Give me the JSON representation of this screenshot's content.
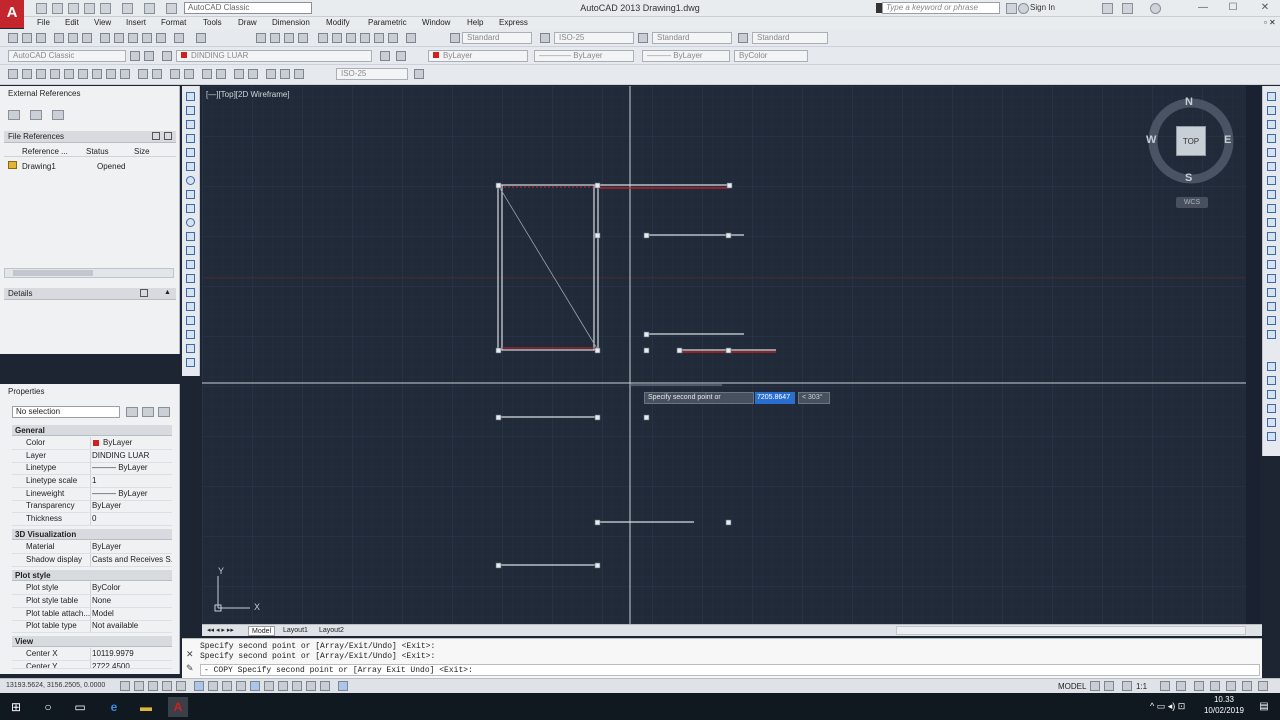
{
  "titlebar": {
    "workspace": "AutoCAD Classic",
    "title": "AutoCAD 2013   Drawing1.dwg",
    "search_placeholder": "Type a keyword or phrase",
    "signin": "Sign In"
  },
  "menu": [
    "File",
    "Edit",
    "View",
    "Insert",
    "Format",
    "Tools",
    "Draw",
    "Dimension",
    "Modify",
    "Parametric",
    "Window",
    "Help",
    "Express"
  ],
  "toolbar": {
    "text_style": "Standard",
    "dim_style": "ISO-25",
    "table_style": "Standard",
    "mleader_style": "Standard",
    "workspace2": "AutoCAD Classic",
    "layer": "DINDING LUAR",
    "color": "ByLayer",
    "linetype": "ByLayer",
    "lineweight": "ByLayer",
    "plotstyle": "ByColor",
    "dimstyle2": "ISO-25"
  },
  "xref": {
    "title": "External References",
    "file_refs": "File References",
    "columns": [
      "Reference ...",
      "Status",
      "Size"
    ],
    "rows": [
      {
        "name": "Drawing1",
        "status": "Opened",
        "size": ""
      }
    ],
    "details": "Details"
  },
  "properties": {
    "title": "Properties",
    "selection": "No selection",
    "sections": {
      "general": "General",
      "viz": "3D Visualization",
      "plot": "Plot style",
      "view": "View"
    },
    "general": [
      {
        "label": "Color",
        "value": "ByLayer"
      },
      {
        "label": "Layer",
        "value": "DINDING LUAR"
      },
      {
        "label": "Linetype",
        "value": "——— ByLayer"
      },
      {
        "label": "Linetype scale",
        "value": "1"
      },
      {
        "label": "Lineweight",
        "value": "——— ByLayer"
      },
      {
        "label": "Transparency",
        "value": "ByLayer"
      },
      {
        "label": "Thickness",
        "value": "0"
      }
    ],
    "viz": [
      {
        "label": "Material",
        "value": "ByLayer"
      },
      {
        "label": "Shadow display",
        "value": "Casts and Receives S..."
      }
    ],
    "plot": [
      {
        "label": "Plot style",
        "value": "ByColor"
      },
      {
        "label": "Plot style table",
        "value": "None"
      },
      {
        "label": "Plot table attach...",
        "value": "Model"
      },
      {
        "label": "Plot table type",
        "value": "Not available"
      }
    ],
    "view": [
      {
        "label": "Center X",
        "value": "10119.9979"
      },
      {
        "label": "Center Y",
        "value": "2722.4500"
      }
    ]
  },
  "canvas": {
    "viewport_label": "[—][Top][2D Wireframe]",
    "prompt": "Specify second point or",
    "dyn_value": "7205.8647",
    "dyn_angle": "< 303°",
    "compass": {
      "n": "N",
      "s": "S",
      "e": "E",
      "w": "W",
      "top": "TOP",
      "wcs": "WCS"
    },
    "ucs_x": "X",
    "ucs_y": "Y"
  },
  "tabs": [
    "Model",
    "Layout1",
    "Layout2"
  ],
  "command": {
    "lines": [
      "Specify second point or [Array/Exit/Undo] <Exit>:",
      "Specify second point or [Array/Exit/Undo] <Exit>:"
    ],
    "current": "- COPY Specify second point or [Array Exit Undo] <Exit>:"
  },
  "status": {
    "coords": "13193.5624, 3156.2505, 0.0000",
    "model": "MODEL",
    "scale": "1:1"
  },
  "taskbar": {
    "time": "10.33",
    "date": "10/02/2019"
  }
}
